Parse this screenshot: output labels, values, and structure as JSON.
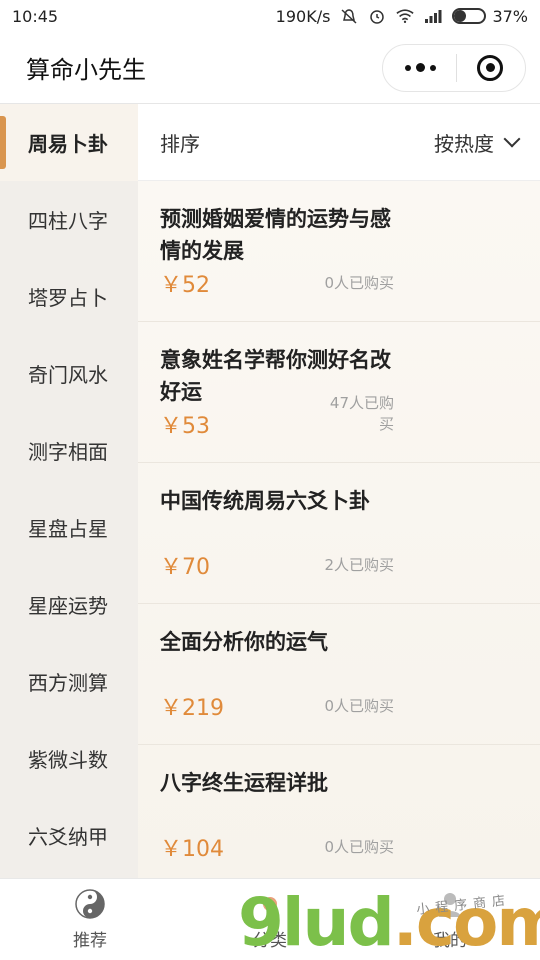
{
  "status_bar": {
    "time": "10:45",
    "speed": "190K/s",
    "battery_text": "37%",
    "battery_level": 0.37,
    "icons": [
      "mute-icon",
      "alarm-icon",
      "wifi-icon",
      "signal-icon",
      "battery-icon"
    ]
  },
  "title_bar": {
    "title": "算命小先生",
    "menu_icon": "more-dots-icon",
    "close_icon": "target-circle-icon"
  },
  "sidebar": {
    "items": [
      {
        "label": "周易卜卦",
        "active": true
      },
      {
        "label": "四柱八字",
        "active": false
      },
      {
        "label": "塔罗占卜",
        "active": false
      },
      {
        "label": "奇门风水",
        "active": false
      },
      {
        "label": "测字相面",
        "active": false
      },
      {
        "label": "星盘占星",
        "active": false
      },
      {
        "label": "星座运势",
        "active": false
      },
      {
        "label": "西方测算",
        "active": false
      },
      {
        "label": "紫微斗数",
        "active": false
      },
      {
        "label": "六爻纳甲",
        "active": false
      }
    ]
  },
  "sort_bar": {
    "label": "排序",
    "selected": "按热度"
  },
  "products": [
    {
      "title": "预测婚姻爱情的运势与感情的发展",
      "price": "￥52",
      "sold": "0人已购买"
    },
    {
      "title": "意象姓名学帮你测好名改好运",
      "price": "￥53",
      "sold": "47人已购买"
    },
    {
      "title": "中国传统周易六爻卜卦",
      "price": "￥70",
      "sold": "2人已购买"
    },
    {
      "title": "全面分析你的运气",
      "price": "￥219",
      "sold": "0人已购买"
    },
    {
      "title": "八字终生运程详批",
      "price": "￥104",
      "sold": "0人已购买"
    }
  ],
  "tab_bar": {
    "tabs": [
      {
        "label": "推荐",
        "icon": "yin-yang-icon"
      },
      {
        "label": "分类",
        "icon": "category-icon"
      },
      {
        "label": "我的",
        "icon": "profile-icon"
      }
    ]
  },
  "watermark": {
    "text_main": "9lud",
    "text_domain": ".com",
    "text_sub": "小程序商店"
  },
  "colors": {
    "accent": "#d9954f",
    "price": "#e08a3a",
    "sidebar_bg": "#f1eeea",
    "watermark_green": "#7cc04a"
  }
}
